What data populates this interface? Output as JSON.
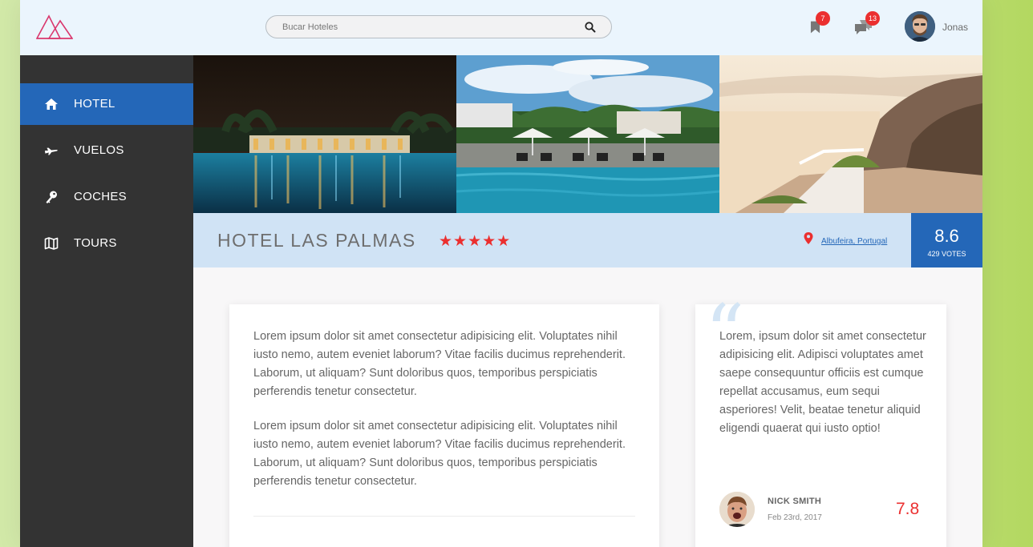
{
  "header": {
    "search": {
      "placeholder": "Bucar Hoteles"
    },
    "bookmarks_count": "7",
    "messages_count": "13",
    "user_name": "Jonas"
  },
  "sidebar": {
    "items": [
      {
        "label": "HOTEL",
        "icon": "home-icon",
        "active": true
      },
      {
        "label": "VUELOS",
        "icon": "plane-icon",
        "active": false
      },
      {
        "label": "COCHES",
        "icon": "key-icon",
        "active": false
      },
      {
        "label": "TOURS",
        "icon": "map-icon",
        "active": false
      }
    ]
  },
  "hotel": {
    "name": "HOTEL LAS PALMAS",
    "stars": "★★★★★",
    "location": "Albufeira, Portugal",
    "rating": "8.6",
    "votes": "429 VOTES"
  },
  "description": {
    "paragraphs": [
      "Lorem ipsum dolor sit amet consectetur adipisicing elit. Voluptates nihil iusto nemo, autem eveniet laborum? Vitae facilis ducimus reprehenderit. Laborum, ut aliquam? Sunt doloribus quos, temporibus perspiciatis perferendis tenetur consectetur.",
      "Lorem ipsum dolor sit amet consectetur adipisicing elit. Voluptates nihil iusto nemo, autem eveniet laborum? Vitae facilis ducimus reprehenderit. Laborum, ut aliquam? Sunt doloribus quos, temporibus perspiciatis perferendis tenetur consectetur."
    ]
  },
  "review": {
    "text": "Lorem, ipsum dolor sit amet consectetur adipisicing elit. Adipisci voluptates amet saepe consequuntur officiis est cumque repellat accusamus, eum sequi asperiores! Velit, beatae tenetur aliquid eligendi quaerat qui iusto optio!",
    "author": "NICK SMITH",
    "date": "Feb 23rd, 2017",
    "score": "7.8"
  },
  "colors": {
    "accent_blue": "#2467b8",
    "accent_red": "#eb2f2f",
    "sidebar_bg": "#333333",
    "header_bg": "#ebf5fd",
    "hotelbar_bg": "#d0e3f5"
  }
}
